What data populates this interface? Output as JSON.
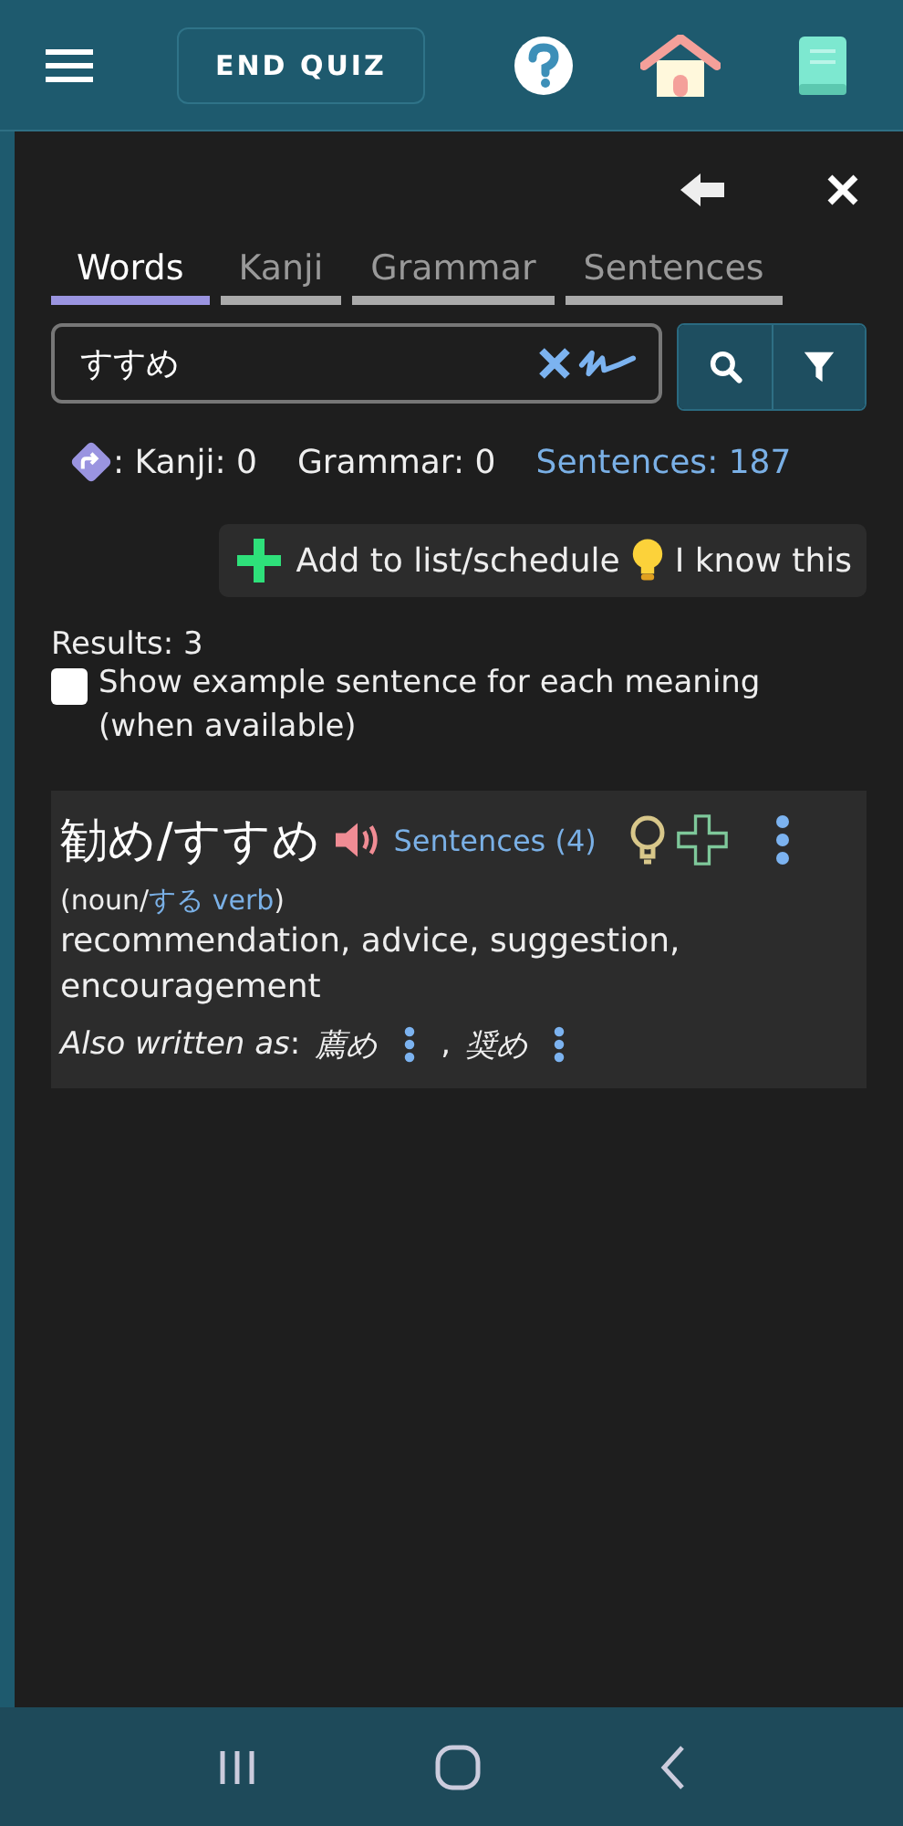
{
  "header": {
    "end_button": "END QUIZ"
  },
  "tabs": [
    {
      "label": "Words",
      "selected": true
    },
    {
      "label": "Kanji",
      "selected": false
    },
    {
      "label": "Grammar",
      "selected": false
    },
    {
      "label": "Sentences",
      "selected": false
    }
  ],
  "search": {
    "value": "すすめ"
  },
  "counts": {
    "kanji": ": Kanji: 0",
    "grammar": "Grammar: 0",
    "sentences": "Sentences: 187"
  },
  "actions": {
    "add": "Add to list/schedule",
    "know": "I know this"
  },
  "results": "Results: 3",
  "example_option": {
    "label": "Show example sentence for each meaning (when available)",
    "checked": false
  },
  "entries": [
    {
      "word": "勧め/すすめ",
      "sentences": "Sentences (4)",
      "pos_before": "(noun/",
      "pos_link": "する verb",
      "pos_after": ")",
      "meaning": "recommendation, advice, suggestion, encouragement",
      "also_label": "*Also written as*:",
      "separator": ",",
      "forms": [
        "薦め",
        "奨め"
      ]
    }
  ]
}
